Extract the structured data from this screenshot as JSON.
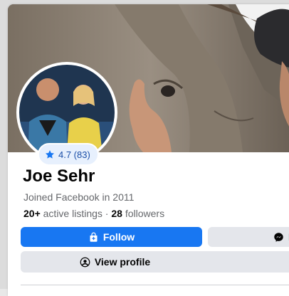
{
  "seller": {
    "name": "Joe Sehr",
    "joined": "Joined Facebook in 2011",
    "listings_count": "20+",
    "listings_label": "active listings",
    "separator": "·",
    "followers_count": "28",
    "followers_label": "followers",
    "rating": "4.7 (83)"
  },
  "actions": {
    "follow_label": "Follow",
    "message_label": "M",
    "view_profile_label": "View profile"
  },
  "colors": {
    "primary": "#1877f2",
    "secondary_button": "#e4e6eb",
    "rating_bg": "#e7f0fd"
  },
  "icons": {
    "follow": "marketplace-follow-icon",
    "message": "messenger-icon",
    "profile": "user-circle-icon",
    "rating": "star-icon"
  }
}
